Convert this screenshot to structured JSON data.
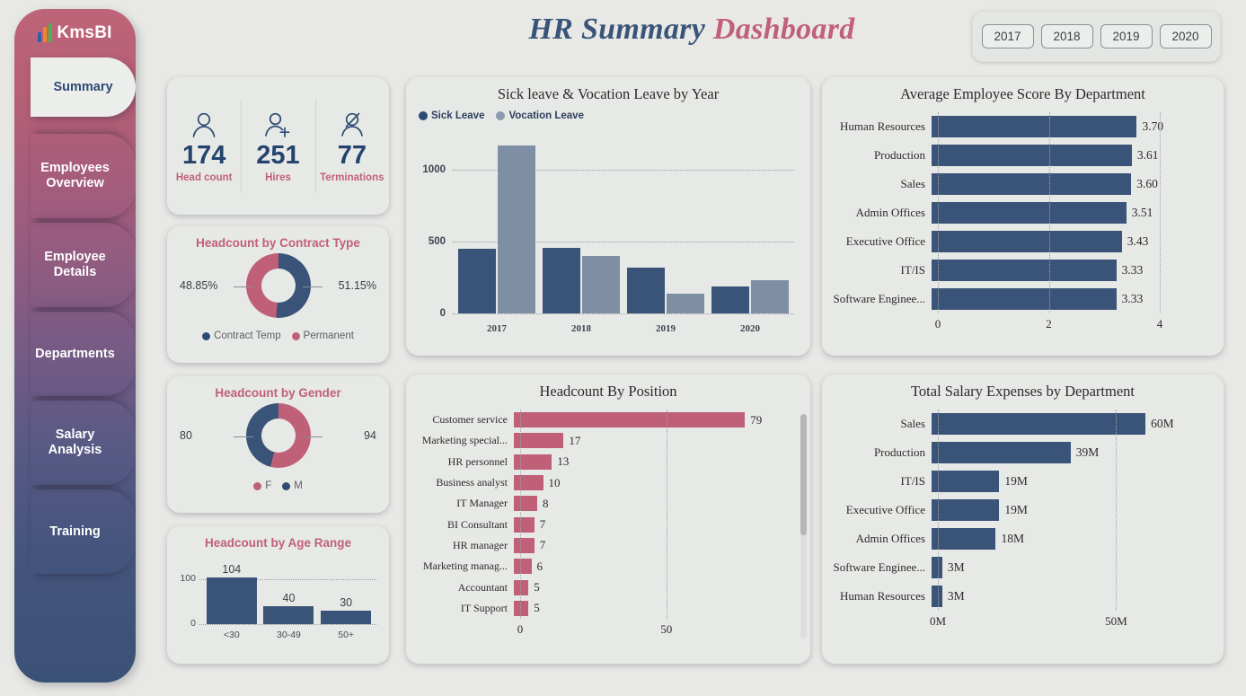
{
  "brand": {
    "name": "KmsBI"
  },
  "header": {
    "title_main": "HR Summary",
    "title_accent": "Dashboard"
  },
  "year_filter": {
    "options": [
      "2017",
      "2018",
      "2019",
      "2020"
    ]
  },
  "sidebar": {
    "items": [
      {
        "label": "Summary",
        "active": true
      },
      {
        "label": "Employees\nOverview",
        "active": false
      },
      {
        "label": "Employee\nDetails",
        "active": false
      },
      {
        "label": "Departments",
        "active": false
      },
      {
        "label": "Salary\nAnalysis",
        "active": false
      },
      {
        "label": "Training",
        "active": false
      }
    ]
  },
  "kpis": [
    {
      "icon": "person-icon",
      "value": "174",
      "label": "Head count"
    },
    {
      "icon": "person-add-icon",
      "value": "251",
      "label": "Hires"
    },
    {
      "icon": "person-remove-icon",
      "value": "77",
      "label": "Terminations"
    }
  ],
  "colors": {
    "navy": "#3a5479",
    "rose": "#c05f78",
    "steel": "#7e8fa3",
    "title_navy": "#3a5479",
    "page_bg": "#e8e9e6",
    "card_bg": "#e7e9e6"
  },
  "cards": {
    "contract": {
      "title": "Headcount by Contract Type"
    },
    "gender": {
      "title": "Headcount by Gender"
    },
    "age": {
      "title": "Headcount by Age Range"
    }
  },
  "chart_data": [
    {
      "id": "contract_type",
      "type": "pie",
      "title": "Headcount by Contract Type",
      "labels": [
        "Contract Temp",
        "Permanent"
      ],
      "values": [
        51.15,
        48.85
      ],
      "value_labels": [
        "51.15%",
        "48.85%"
      ],
      "colors": [
        "#3a5479",
        "#c05f78"
      ],
      "legend_position": "bottom",
      "donut": true
    },
    {
      "id": "gender",
      "type": "pie",
      "title": "Headcount by Gender",
      "labels": [
        "F",
        "M"
      ],
      "values": [
        94,
        80
      ],
      "value_labels": [
        "94",
        "80"
      ],
      "colors": [
        "#c05f78",
        "#3a5479"
      ],
      "legend_position": "bottom",
      "donut": true
    },
    {
      "id": "age_range",
      "type": "bar",
      "title": "Headcount by Age Range",
      "categories": [
        "<30",
        "30-49",
        "50+"
      ],
      "values": [
        104,
        40,
        30
      ],
      "xlabel": "",
      "ylabel": "",
      "ylim": [
        0,
        115
      ],
      "yticks": [
        "0",
        "100"
      ],
      "grid": true
    },
    {
      "id": "sick_vocation",
      "type": "bar",
      "title": "Sick leave & Vocation Leave by Year",
      "categories": [
        "2017",
        "2018",
        "2019",
        "2020"
      ],
      "series": [
        {
          "name": "Sick Leave",
          "values": [
            450,
            455,
            320,
            190
          ],
          "color": "#3a5479"
        },
        {
          "name": "Vocation Leave",
          "values": [
            1165,
            400,
            135,
            230
          ],
          "color": "#7e8fa3"
        }
      ],
      "ylim": [
        0,
        1260
      ],
      "yticks": [
        "0",
        "500",
        "1000"
      ],
      "legend_position": "top-left",
      "grid": true
    },
    {
      "id": "avg_score_by_dept",
      "type": "bar",
      "orientation": "horizontal",
      "title": "Average Employee Score By Department",
      "categories": [
        "Human Resources",
        "Production",
        "Sales",
        "Admin Offices",
        "Executive Office",
        "IT/IS",
        "Software Enginee..."
      ],
      "values": [
        3.7,
        3.61,
        3.6,
        3.51,
        3.43,
        3.33,
        3.33
      ],
      "value_labels": [
        "3.70",
        "3.61",
        "3.60",
        "3.51",
        "3.43",
        "3.33",
        "3.33"
      ],
      "xlim": [
        0,
        4
      ],
      "xticks": [
        "0",
        "2",
        "4"
      ],
      "color": "#3a5479",
      "grid": true
    },
    {
      "id": "headcount_by_position",
      "type": "bar",
      "orientation": "horizontal",
      "title": "Headcount By Position",
      "categories": [
        "Customer service",
        "Marketing special...",
        "HR personnel",
        "Business analyst",
        "IT Manager",
        "BI Consultant",
        "HR manager",
        "Marketing manag...",
        "Accountant",
        "IT Support"
      ],
      "values": [
        79,
        17,
        13,
        10,
        8,
        7,
        7,
        6,
        5,
        5
      ],
      "value_labels": [
        "79",
        "17",
        "13",
        "10",
        "8",
        "7",
        "7",
        "6",
        "5",
        "5"
      ],
      "xlim": [
        0,
        86
      ],
      "xticks": [
        "0",
        "50"
      ],
      "color": "#c05f78",
      "grid": true,
      "scrollable": true
    },
    {
      "id": "salary_by_dept",
      "type": "bar",
      "orientation": "horizontal",
      "title": "Total Salary Expenses by Department",
      "categories": [
        "Sales",
        "Production",
        "IT/IS",
        "Executive Office",
        "Admin Offices",
        "Software Enginee...",
        "Human Resources"
      ],
      "values": [
        60,
        39,
        19,
        19,
        18,
        3,
        3
      ],
      "value_labels": [
        "60M",
        "39M",
        "19M",
        "19M",
        "18M",
        "3M",
        "3M"
      ],
      "xlim": [
        0,
        65
      ],
      "xticks": [
        "0M",
        "50M"
      ],
      "color": "#3a5479",
      "grid": true
    }
  ]
}
